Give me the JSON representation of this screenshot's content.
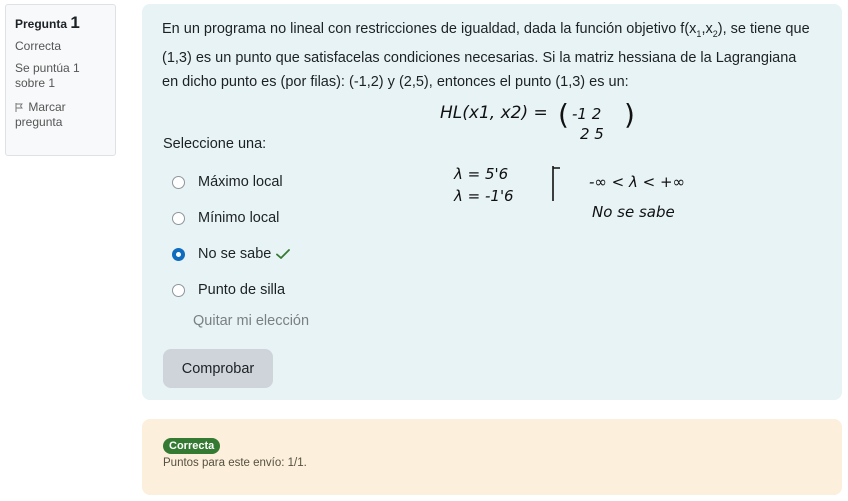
{
  "info": {
    "question_label": "Pregunta",
    "question_number": "1",
    "state": "Correcta",
    "grade": "Se puntúa 1 sobre 1",
    "flag_label": "Marcar pregunta"
  },
  "question": {
    "text_part1": "En un programa no lineal con restricciones de igualdad, dada la función objetivo f(x",
    "sub1": "1",
    "comma": ",x",
    "sub2": "2",
    "text_part2": "), se tiene que (1,3) es un punto que satisfacelas condiciones necesarias. Si la matriz hessiana de la Lagrangiana en dicho punto es (por filas): (-1,2) y (2,5), entonces el punto (1,3) es un:",
    "prompt": "Seleccione una:",
    "options": [
      {
        "label": "Máximo local",
        "checked": false
      },
      {
        "label": "Mínimo local",
        "checked": false
      },
      {
        "label": "No se sabe",
        "checked": true
      },
      {
        "label": "Punto de silla",
        "checked": false
      }
    ],
    "clear_choice": "Quitar mi elección",
    "check_button": "Comprobar"
  },
  "handwriting": {
    "line1": "HL(x1, x2) =",
    "matrix_row1": "-1  2",
    "matrix_row2": "2  5",
    "lambda1": "λ = 5'6",
    "lambda2": "λ = -1'6",
    "range": "-∞ < λ < +∞",
    "conclusion": "No se sabe"
  },
  "outcome": {
    "badge": "Correcta",
    "points": "Puntos para este envío: 1/1."
  },
  "colors": {
    "formulation_bg": "#e7f3f5",
    "outcome_bg": "#fcefdc",
    "badge_bg": "#357a32",
    "radio_checked": "#0f6cbf",
    "check_mark": "#357a32"
  }
}
